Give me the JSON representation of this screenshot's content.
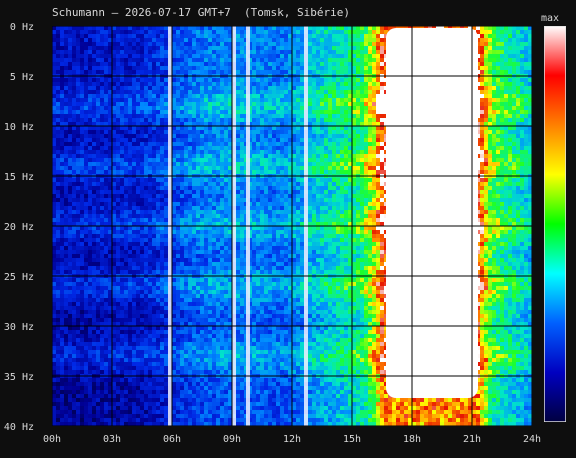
{
  "title": "Schumann — 2026-07-17 GMT+7  (Tomsk, Sibérie)",
  "colorbar_label": "max",
  "colors": {
    "background": "#0e0e0e",
    "grid": "#000000",
    "saturated": "#ffffff",
    "text": "#d8d8d8"
  },
  "chart_data": {
    "type": "heatmap",
    "title": "Schumann — 2026-07-17 GMT+7  (Tomsk, Sibérie)",
    "x_ticks": [
      "00h",
      "03h",
      "06h",
      "09h",
      "12h",
      "15h",
      "18h",
      "21h",
      "24h"
    ],
    "x_range_hours": [
      0,
      24
    ],
    "y_ticks": [
      "0 Hz",
      "5 Hz",
      "10 Hz",
      "15 Hz",
      "20 Hz",
      "25 Hz",
      "30 Hz",
      "35 Hz",
      "40 Hz"
    ],
    "y_range_hz": [
      0,
      40
    ],
    "grid": true,
    "colorbar": {
      "top_label": "max",
      "colors": [
        "#ffffff",
        "#ff0000",
        "#ff8000",
        "#ffff00",
        "#00ff00",
        "#00ffff",
        "#0060ff",
        "#0000c0",
        "#000040"
      ]
    },
    "background_level_by_hour": [
      [
        0,
        0.22
      ],
      [
        4.5,
        0.26
      ],
      [
        5.8,
        0.33
      ],
      [
        7.5,
        0.42
      ],
      [
        9.5,
        0.45
      ],
      [
        11.5,
        0.42
      ],
      [
        12.5,
        0.48
      ],
      [
        13.5,
        0.55
      ],
      [
        15.5,
        0.65
      ],
      [
        16.2,
        0.82
      ],
      [
        16.5,
        0.95
      ],
      [
        21.3,
        0.95
      ],
      [
        22.0,
        0.7
      ],
      [
        24,
        0.52
      ]
    ],
    "resonance_bands_hz": [
      8,
      14,
      20,
      26,
      33
    ],
    "saturated_region": {
      "start_hour": 16.5,
      "end_hour": 21.5,
      "from_hz": 0,
      "to_hz": 40
    },
    "bright_vertical_streaks_hours": [
      5.9,
      9.1,
      9.8,
      12.7
    ]
  }
}
